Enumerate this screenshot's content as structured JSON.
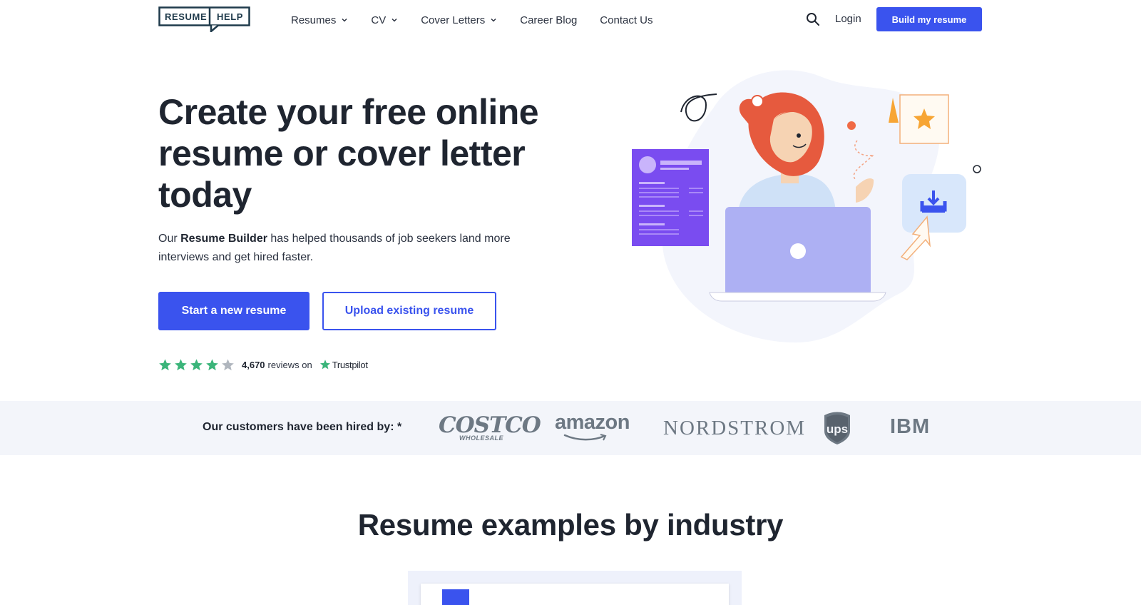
{
  "nav": {
    "logo_left": "RESUME",
    "logo_right": "HELP",
    "links": [
      {
        "label": "Resumes",
        "dropdown": true
      },
      {
        "label": "CV",
        "dropdown": true
      },
      {
        "label": "Cover Letters",
        "dropdown": true
      },
      {
        "label": "Career Blog",
        "dropdown": false
      },
      {
        "label": "Contact Us",
        "dropdown": false
      }
    ],
    "login": "Login",
    "cta": "Build my resume"
  },
  "hero": {
    "title": "Create your free online resume or cover letter today",
    "sub_pre": "Our ",
    "sub_bold": "Resume Builder",
    "sub_post": " has helped thousands of job seekers land more interviews and get hired faster.",
    "primary_button": "Start a new resume",
    "secondary_button": "Upload existing resume",
    "rating": {
      "stars": 4,
      "max_stars": 5,
      "count": "4,670",
      "text": "reviews on",
      "platform": "Trustpilot"
    }
  },
  "hired": {
    "label": "Our customers have been hired by: *",
    "brands": {
      "costco": "COSTCO",
      "costco_sub": "WHOLESALE",
      "amazon": "amazon",
      "nordstrom": "NORDSTROM",
      "ups": "ups",
      "ibm": "IBM"
    }
  },
  "section": {
    "title": "Resume examples by industry"
  },
  "colors": {
    "brand_blue": "#3a53ee",
    "dark_text": "#1f2530",
    "logo_teal": "#1f3a4b",
    "star_green": "#3bb57a",
    "star_gray": "#b0b6be",
    "hired_bg": "#f3f5fa",
    "illustration_purple": "#7a4cf0",
    "illustration_laptop": "#adb0f3"
  },
  "icons": {
    "search": "search-icon",
    "chevron": "chevron-down-icon",
    "star": "star-icon",
    "trustpilot": "trustpilot-star-icon"
  }
}
